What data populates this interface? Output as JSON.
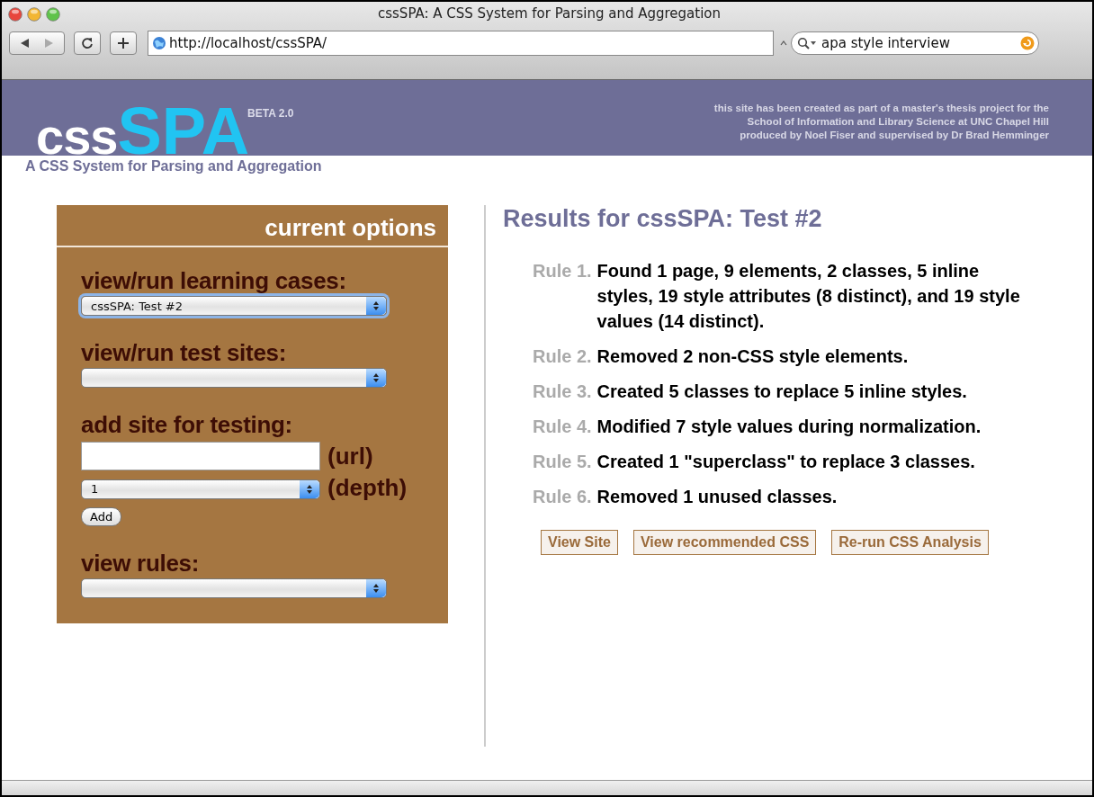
{
  "window": {
    "title": "cssSPA: A CSS System for Parsing and Aggregation"
  },
  "toolbar": {
    "url": "http://localhost/cssSPA/",
    "search": "apa style interview"
  },
  "header": {
    "logo_light": "css",
    "logo_bright": "SPA",
    "beta": "BETA 2.0",
    "credits": [
      "this site has been created as part of a master's thesis project for the",
      "School of Information and Library Science at UNC Chapel Hill",
      "produced by Noel Fiser and supervised by Dr Brad Hemminger"
    ],
    "tagline": "A CSS System for Parsing and Aggregation"
  },
  "sidebar": {
    "title": "current options",
    "sections": [
      {
        "kind": "select",
        "label": "view/run learning cases:",
        "value": "cssSPA: Test #2",
        "focused": true
      },
      {
        "kind": "select",
        "label": "view/run test sites:",
        "focused": false
      },
      {
        "kind": "add-site",
        "label": "add site for testing:",
        "url_suffix": "(url)",
        "depth_value": "1",
        "depth_suffix": "(depth)",
        "button": "Add"
      },
      {
        "kind": "select",
        "label": "view rules:",
        "focused": false
      }
    ]
  },
  "results": {
    "title": "Results for cssSPA: Test #2",
    "rules": [
      {
        "label": "Rule 1.",
        "text": "Found 1 page, 9 elements, 2 classes, 5 inline styles, 19 style attributes (8 distinct), and 19 style values (14 distinct)."
      },
      {
        "label": "Rule 2.",
        "text": "Removed 2 non-CSS style elements."
      },
      {
        "label": "Rule 3.",
        "text": "Created 5 classes to replace 5 inline styles."
      },
      {
        "label": "Rule 4.",
        "text": "Modified 7 style values during normalization."
      },
      {
        "label": "Rule 5.",
        "text": "Created 1 \"superclass\" to replace 3 classes."
      },
      {
        "label": "Rule 6.",
        "text": "Removed 1 unused classes."
      }
    ],
    "buttons": [
      "View Site",
      "View recommended CSS",
      "Re-run CSS Analysis"
    ]
  }
}
